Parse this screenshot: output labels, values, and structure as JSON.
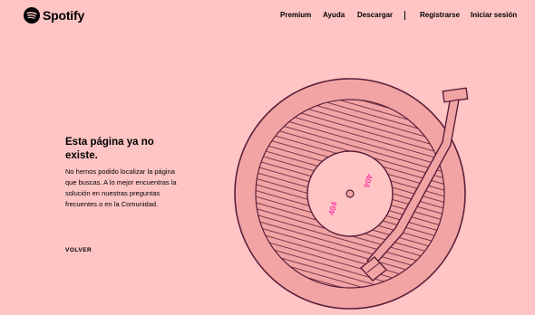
{
  "header": {
    "brand": "Spotify",
    "nav": {
      "premium": "Premium",
      "help": "Ayuda",
      "download": "Descargar",
      "signup": "Registrarse",
      "login": "Iniciar sesión"
    }
  },
  "main": {
    "title": "Esta página ya no existe.",
    "description": "No hemos podido localizar la página que buscas. A lo mejor encuentras la solución en nuestras preguntas frecuentes o en la Comunidad.",
    "back_label": "VOLVER"
  },
  "record": {
    "label_text": "404"
  },
  "colors": {
    "background": "#ffc4c4",
    "record_fill": "#f2a4a4",
    "record_outline": "#5a1f3a",
    "label_text": "#ff3ca6"
  }
}
